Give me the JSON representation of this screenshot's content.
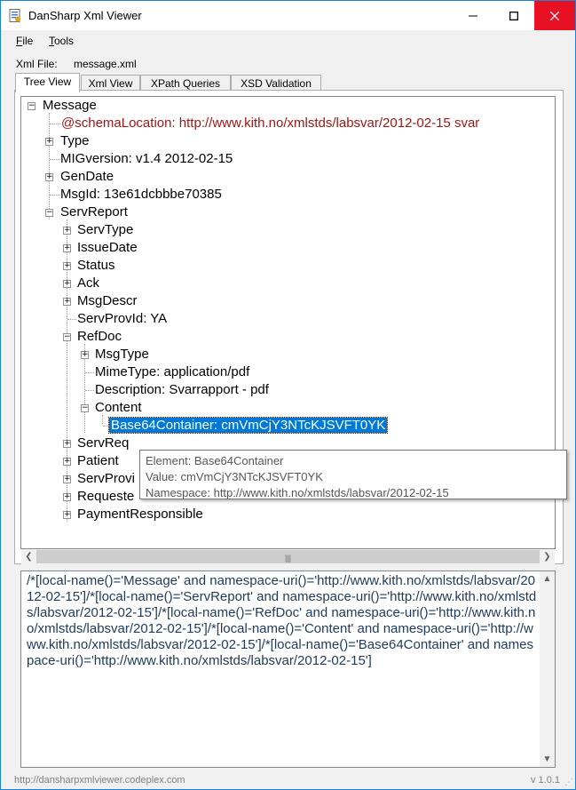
{
  "window": {
    "title": "DanSharp Xml Viewer",
    "accent": "#1883d7",
    "close_hover": "#e81123"
  },
  "menu": {
    "file_prefix": "F",
    "file_rest": "ile",
    "tools_prefix": "T",
    "tools_rest": "ools"
  },
  "xml_file": {
    "label": "Xml File:",
    "value": "message.xml"
  },
  "tabs": [
    {
      "label": "Tree View"
    },
    {
      "label": "Xml View"
    },
    {
      "label": "XPath Queries"
    },
    {
      "label": "XSD Validation"
    }
  ],
  "tree": {
    "nodes": [
      {
        "text": "Message",
        "expander": "-"
      },
      {
        "text": "@schemaLocation: http://www.kith.no/xmlstds/labsvar/2012-02-15 svar"
      },
      {
        "text": "Type",
        "expander": "+"
      },
      {
        "text": "MIGversion: v1.4 2012-02-15"
      },
      {
        "text": "GenDate",
        "expander": "+"
      },
      {
        "text": "MsgId: 13e61dcbbbe70385"
      },
      {
        "text": "ServReport",
        "expander": "-"
      },
      {
        "text": "ServType",
        "expander": "+"
      },
      {
        "text": "IssueDate",
        "expander": "+"
      },
      {
        "text": "Status",
        "expander": "+"
      },
      {
        "text": "Ack",
        "expander": "+"
      },
      {
        "text": "MsgDescr",
        "expander": "+"
      },
      {
        "text": "ServProvId: YA"
      },
      {
        "text": "RefDoc",
        "expander": "-"
      },
      {
        "text": "MsgType",
        "expander": "+"
      },
      {
        "text": "MimeType: application/pdf"
      },
      {
        "text": "Description: Svarrapport - pdf"
      },
      {
        "text": "Content",
        "expander": "-"
      },
      {
        "text": "Base64Container: cmVmCjY3NTcKJSVFT0YK"
      },
      {
        "text": "ServReq",
        "expander": "+"
      },
      {
        "text": "Patient",
        "expander": "+"
      },
      {
        "text": "ServProvi",
        "expander": "+"
      },
      {
        "text": "Requeste",
        "expander": "+"
      },
      {
        "text": "PaymentResponsible",
        "expander": "+"
      }
    ]
  },
  "tooltip": {
    "line1": "Element: Base64Container",
    "line2": "Value: cmVmCjY3NTcKJSVFT0YK",
    "line3": "Namespace: http://www.kith.no/xmlstds/labsvar/2012-02-15"
  },
  "xpath": "/*[local-name()='Message' and namespace-uri()='http://www.kith.no/xmlstds/labsvar/2012-02-15']/*[local-name()='ServReport' and namespace-uri()='http://www.kith.no/xmlstds/labsvar/2012-02-15']/*[local-name()='RefDoc' and namespace-uri()='http://www.kith.no/xmlstds/labsvar/2012-02-15']/*[local-name()='Content' and namespace-uri()='http://www.kith.no/xmlstds/labsvar/2012-02-15']/*[local-name()='Base64Container' and namespace-uri()='http://www.kith.no/xmlstds/labsvar/2012-02-15']",
  "status": {
    "url": "http://dansharpxmlviewer.codeplex.com",
    "version": "v 1.0.1"
  }
}
